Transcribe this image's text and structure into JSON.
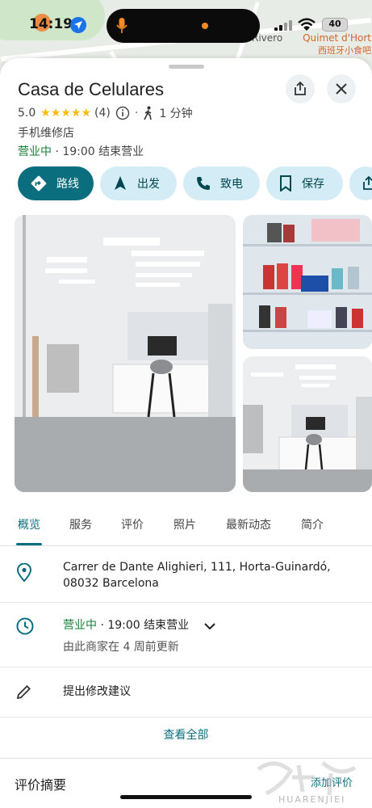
{
  "status_bar": {
    "time": "14:19",
    "battery": "40"
  },
  "map": {
    "street_label": "Rivero",
    "poi_label_1": "Quimet d'Hort",
    "poi_label_2": "西班牙小食吧"
  },
  "place": {
    "name": "Casa de Celulares",
    "rating": "5.0",
    "stars": "★★★★★",
    "review_count": "(4)",
    "walk_time": "1 分钟",
    "category": "手机维修店",
    "status": "营业中",
    "hours_note": "· 19:00 结束营业"
  },
  "actions": [
    {
      "label": "路线",
      "icon": "directions-icon"
    },
    {
      "label": "出发",
      "icon": "navigation-arrow-icon"
    },
    {
      "label": "致电",
      "icon": "phone-icon"
    },
    {
      "label": "保存",
      "icon": "bookmark-icon"
    }
  ],
  "tabs": [
    "概览",
    "服务",
    "评价",
    "照片",
    "最新动态",
    "简介"
  ],
  "active_tab": "概览",
  "info": {
    "address_line1": "Carrer de Dante Alighieri, 111, Horta-Guinardó,",
    "address_line2": "08032 Barcelona",
    "hours_status": "营业中",
    "hours_close": "· 19:00 结束营业",
    "hours_updated": "由此商家在 4 周前更新",
    "suggest_edit": "提出修改建议"
  },
  "see_all": "查看全部",
  "review_summary": "评价摘要",
  "add_review": "添加评价",
  "watermark": "HUARENJIEI",
  "colors": {
    "accent": "#0b6e7e",
    "chip_bg": "#d3ecf5",
    "open_green": "#188038",
    "star": "#fbbc04"
  }
}
